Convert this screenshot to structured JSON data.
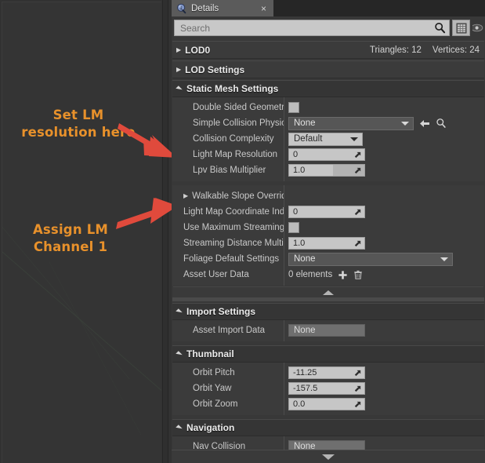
{
  "annotations": {
    "note1": "Set LM\nresolution here",
    "note2": "Assign LM\nChannel 1",
    "color": "#E8912B",
    "arrow_color": "#E04A3C"
  },
  "panel": {
    "tab": {
      "label": "Details",
      "icon": "details-info-icon",
      "close": "×"
    },
    "search": {
      "placeholder": "Search",
      "search_icon": "search-icon",
      "grid_icon": "grid-view-icon",
      "eye_icon": "eye-icon"
    },
    "collapsed_sections": [
      {
        "title": "LOD0",
        "stats": [
          "Triangles: 12",
          "Vertices: 24"
        ]
      },
      {
        "title": "LOD Settings",
        "stats": []
      }
    ],
    "categories": [
      {
        "title": "Static Mesh Settings",
        "rows": [
          {
            "label": "Double Sided Geometry",
            "widget": "checkbox",
            "value": "",
            "checked": false
          },
          {
            "label": "Simple Collision Physical",
            "widget": "combo-dark",
            "value": "None",
            "extra": [
              "back-arrow-icon",
              "browse-icon"
            ]
          },
          {
            "label": "Collision Complexity",
            "widget": "combo-light",
            "value": "Default"
          },
          {
            "label": "Light Map Resolution",
            "widget": "number",
            "value": "0"
          },
          {
            "label": "Lpv Bias Multiplier",
            "widget": "number-slider",
            "value": "1.0"
          }
        ]
      },
      {
        "title": "",
        "rows": [
          {
            "label": "Walkable Slope Override",
            "widget": "expander",
            "value": ""
          },
          {
            "label": "Light Map Coordinate Inde",
            "widget": "number",
            "value": "0"
          },
          {
            "label": "Use Maximum Streaming",
            "widget": "checkbox",
            "value": "",
            "checked": false
          },
          {
            "label": "Streaming Distance Multi",
            "widget": "number",
            "value": "1.0"
          },
          {
            "label": "Foliage Default Settings",
            "widget": "combo-dark-wide",
            "value": "None"
          },
          {
            "label": "Asset User Data",
            "widget": "elements",
            "value": "0 elements",
            "extra": [
              "plus-icon",
              "trash-icon"
            ]
          }
        ]
      },
      {
        "title": "Import Settings",
        "rows": [
          {
            "label": "Asset Import Data",
            "widget": "object",
            "value": "None"
          }
        ]
      },
      {
        "title": "Thumbnail",
        "rows": [
          {
            "label": "Orbit Pitch",
            "widget": "number",
            "value": "-11.25"
          },
          {
            "label": "Orbit Yaw",
            "widget": "number",
            "value": "-157.5"
          },
          {
            "label": "Orbit Zoom",
            "widget": "number",
            "value": "0.0"
          }
        ]
      },
      {
        "title": "Navigation",
        "rows": [
          {
            "label": "Nav Collision",
            "widget": "object",
            "value": "None"
          }
        ]
      }
    ]
  }
}
